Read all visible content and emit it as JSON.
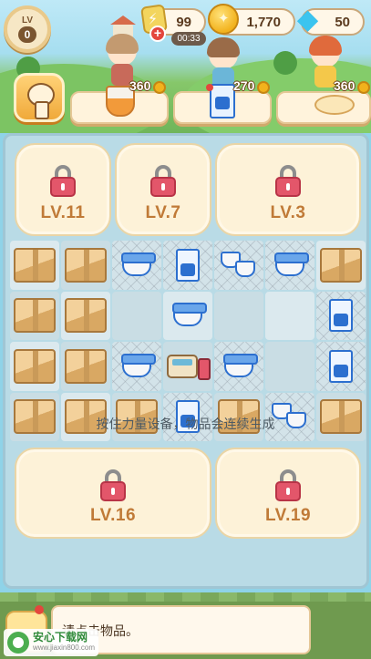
{
  "hud": {
    "level_label": "LV",
    "level": "0",
    "energy": "99",
    "energy_timer": "00:33",
    "coins": "1,770",
    "gems": "50"
  },
  "orders": [
    {
      "reward": "360",
      "item_icon": "noodle-cup-icon"
    },
    {
      "reward": "270",
      "item_icon": "milk-carton-icon"
    },
    {
      "reward": "360",
      "item_icon": "dough-icon"
    }
  ],
  "locks": {
    "top": [
      "LV.11",
      "LV.7",
      "LV.3"
    ],
    "bottom": [
      "LV.16",
      "LV.19"
    ]
  },
  "grid": [
    [
      "box",
      "box",
      "cup-web",
      "carton-web",
      "pair-web",
      "cup-web",
      "box"
    ],
    [
      "box",
      "box",
      "empty",
      "cup",
      "empty",
      "empty",
      "carton-web"
    ],
    [
      "box",
      "box",
      "cup-web",
      "register",
      "cup-web",
      "empty",
      "carton-web"
    ],
    [
      "box",
      "box",
      "box",
      "carton-web",
      "box",
      "pair-web",
      "box"
    ]
  ],
  "hint_text": "按住力量设备，物品会连续生成",
  "dialog_text": "请点击物品。",
  "watermark": {
    "title": "安心下载网",
    "url": "www.jiaxin800.com"
  },
  "colors": {
    "lock_text": "#c07a37",
    "padlock": "#e3566a",
    "accent_blue": "#2c6fcf"
  }
}
